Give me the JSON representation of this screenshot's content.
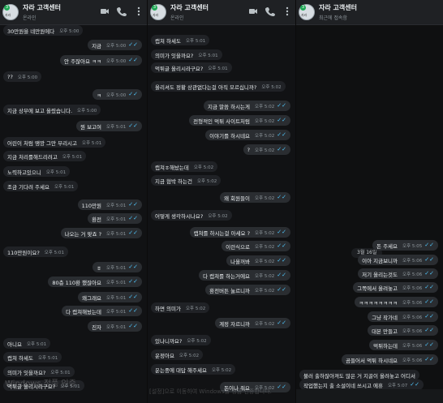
{
  "chat": {
    "title": "자라 고객센터",
    "status_online": "온라인",
    "status_recent": "최근에 접속함"
  },
  "avatar": {
    "badge": "3",
    "name": "자라"
  },
  "icons": [
    "video-icon",
    "phone-icon",
    "more-icon"
  ],
  "colors": {
    "bg": "#111214",
    "header": "#1f2124",
    "bubble_out": "#2a2d31",
    "bubble_in": "#202226",
    "read_check": "#4fc3f7"
  },
  "panel1": {
    "messages": [
      {
        "text": "30만원을 네만원에다",
        "time": "오후 5:00"
      },
      {
        "text": "지금",
        "time": "오후 5:00",
        "check": "✓✓"
      },
      {
        "text": "안 주잖아요 ㅋㅋ",
        "time": "오후 5:00",
        "check": "✓✓"
      },
      {
        "text": "??",
        "time": "오후 5:00"
      },
      {
        "text": "ㅋ",
        "time": "오후 5:00",
        "check": "✓✓"
      },
      {
        "text": "지금 상부에 보고 올렸습니다.",
        "time": "오후 5:00"
      },
      {
        "text": "뭔 보고여",
        "time": "오후 5:01",
        "check": "✓✓"
      },
      {
        "text": "어린이 처럼 땡깡 그만 부리시고",
        "time": "오후 5:01"
      },
      {
        "text": "지금 처리를해드리려고",
        "time": "오후 5:01"
      },
      {
        "text": "노력하고있으니",
        "time": "오후 5:01"
      },
      {
        "text": "조금 기다려 주세요",
        "time": "오후 5:01"
      },
      {
        "text": "110만원",
        "time": "오후 5:01",
        "check": "✓✓"
      },
      {
        "text": "환전",
        "time": "오후 5:01",
        "check": "✓✓"
      },
      {
        "text": "나오는 거 맞죠 ?",
        "time": "오후 5:01",
        "check": "✓✓"
      },
      {
        "text": "110만원이요?",
        "time": "오후 5:01"
      },
      {
        "text": "ㅎ",
        "time": "오후 5:01",
        "check": "✓✓"
      },
      {
        "text": "80층 110환 했잖아요",
        "time": "오후 5:01",
        "check": "✓✓"
      },
      {
        "text": "왜그래요",
        "time": "오후 5:01",
        "check": "✓✓"
      },
      {
        "text": "다 캡쳐해놨는데",
        "time": "오후 5:01",
        "check": "✓✓"
      },
      {
        "text": "진자",
        "time": "오후 5:01",
        "check": "✓✓"
      },
      {
        "text": "아니요",
        "time": "오후 5:01"
      },
      {
        "text": "캡쳐 하세도",
        "time": "오후 5:01"
      },
      {
        "text": "의미가 잇을까요?",
        "time": "오후 5:01"
      },
      {
        "text": "먹튀글 올리시라구요?",
        "time": "오후 5:01"
      }
    ]
  },
  "panel2": {
    "messages": [
      {
        "text": "캡쳐 하세도",
        "time": "오후 5:01"
      },
      {
        "text": "의미가 잇을까요?",
        "time": "오후 5:01"
      },
      {
        "text": "먹튀글 올리시라구요?",
        "time": "오후 5:01"
      },
      {
        "text": "올리셔도 정황 상관없다는걸 아직 모르십니까?",
        "time": "오후 5:02"
      },
      {
        "text": "지금 말씀 하시는게",
        "time": "오후 5:02",
        "check": "✓✓"
      },
      {
        "text": "전형적인 먹튀 사이트처럼",
        "time": "오후 5:02",
        "check": "✓✓"
      },
      {
        "text": "이야기를 하시네요",
        "time": "오후 5:02",
        "check": "✓✓"
      },
      {
        "text": "?",
        "time": "오후 5:02",
        "check": "✓✓"
      },
      {
        "text": "캡쳐ㅎ해놨는데",
        "time": "오후 5:02"
      },
      {
        "text": "지금 협박 하는건",
        "time": "오후 5:02"
      },
      {
        "text": "왜 회원들이",
        "time": "오후 5:02",
        "check": "✓✓"
      },
      {
        "text": "어떻게 생각하시나요?",
        "time": "오후 5:02"
      },
      {
        "text": "캡쳐를 하시는걸 아세요 ?",
        "time": "오후 5:02",
        "check": "✓✓"
      },
      {
        "text": "이런식으로",
        "time": "오후 5:02",
        "check": "✓✓"
      },
      {
        "text": "나올꺼봐",
        "time": "오후 5:02",
        "check": "✓✓"
      },
      {
        "text": "다 캡쳐를 하는거에요",
        "time": "오후 5:02",
        "check": "✓✓"
      },
      {
        "text": "환전버튼 눌르니까",
        "time": "오후 5:02",
        "check": "✓✓"
      },
      {
        "text": "하면 의미가",
        "time": "오후 5:02"
      },
      {
        "text": "계정 자르니까",
        "time": "오후 5:02",
        "check": "✓✓"
      },
      {
        "text": "있나니까요?",
        "time": "오후 5:02"
      },
      {
        "text": "운정아요",
        "time": "오후 5:02"
      },
      {
        "text": "운는중에 대답 해주세요",
        "time": "오후 5:02"
      },
      {
        "text": "돈이나 줘요",
        "time": "오후 5:02",
        "check": "✓✓"
      }
    ]
  },
  "panel3": {
    "date": "3월 16일",
    "messages": [
      {
        "text": "돈 주세요",
        "time": "오후 5:05",
        "check": "✓✓"
      },
      {
        "text": "이아 지금보니까",
        "time": "오후 5:06",
        "check": "✓✓"
      },
      {
        "text": "저기 올리는것도",
        "time": "오후 5:06",
        "check": "✓✓"
      },
      {
        "text": "그쪽에서 올려놓고",
        "time": "오후 5:06",
        "check": "✓✓"
      },
      {
        "text": "ㅋㅋㅋㅋㅋㅋㅋㅋ",
        "time": "오후 5:06",
        "check": "✓✓"
      },
      {
        "text": "그냥 작가네",
        "time": "오후 5:06",
        "check": "✓✓"
      },
      {
        "text": "대본 만들고",
        "time": "오후 5:06",
        "check": "✓✓"
      },
      {
        "text": "먹튀하는데",
        "time": "오후 5:06",
        "check": "✓✓"
      },
      {
        "text": "곰들어서 먹튀 하시네요",
        "time": "오후 5:06",
        "check": "✓✓"
      },
      {
        "text": "불러 출하잖아져도 많은 거 지골이 올려놓고 어디서",
        "time": ""
      },
      {
        "text": "작업했는지 출 소설이네 쓰시고 에휴",
        "time": "오후 5:07",
        "check": "✓✓"
      }
    ]
  },
  "watermark": {
    "line1": "Windows 정품 인증",
    "line2": "[설정]으로 이동하여 Windows를 정품 인증합니다."
  }
}
